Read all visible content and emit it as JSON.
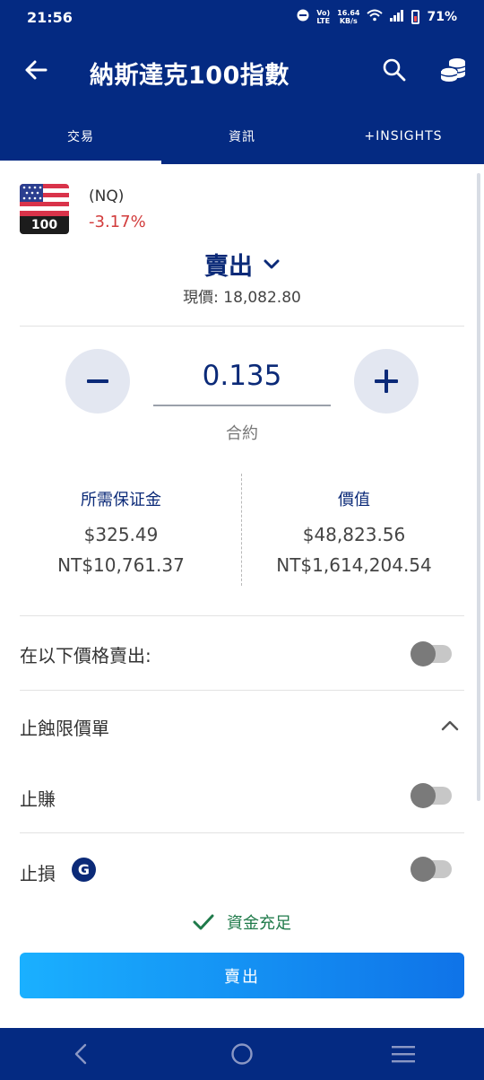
{
  "status_bar": {
    "time": "21:56",
    "net_top": "Vo)",
    "net_bottom": "LTE",
    "speed_top": "16.64",
    "speed_bottom": "KB/s",
    "battery": "71%"
  },
  "header": {
    "title": "納斯達克100指數"
  },
  "tabs": [
    {
      "label": "交易",
      "active": true
    },
    {
      "label": "資訊",
      "active": false
    },
    {
      "label": "+INSIGHTS",
      "active": false
    }
  ],
  "instrument": {
    "symbol": "(NQ)",
    "change": "-3.17%",
    "flag_label": "100"
  },
  "order": {
    "side": "賣出",
    "current_price": "現價: 18,082.80",
    "quantity": "0.135",
    "unit": "合約",
    "margin_label": "所需保证金",
    "margin_usd": "$325.49",
    "margin_twd": "NT$10,761.37",
    "value_label": "價值",
    "value_usd": "$48,823.56",
    "value_twd": "NT$1,614,204.54"
  },
  "options": {
    "sell_at_price_label": "在以下價格賣出:",
    "stop_limit_label": "止蝕限價單",
    "take_profit_label": "止賺",
    "stop_loss_label": "止損",
    "g_badge": "G"
  },
  "funds_status": "資金充足",
  "submit_label": "賣出",
  "colors": {
    "primary": "#042a82",
    "negative": "#d23c3c",
    "success": "#1f7a4a",
    "button_start": "#1ab0ff",
    "button_end": "#0f73e8"
  }
}
